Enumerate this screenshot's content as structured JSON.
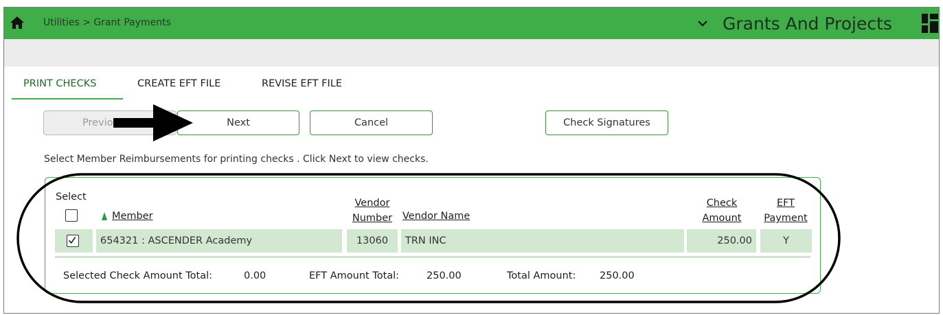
{
  "header": {
    "breadcrumb": "Utilities > Grant Payments",
    "module_title": "Grants And Projects"
  },
  "tabs": [
    {
      "label": "PRINT CHECKS",
      "active": true
    },
    {
      "label": "CREATE EFT FILE",
      "active": false
    },
    {
      "label": "REVISE EFT FILE",
      "active": false
    }
  ],
  "buttons": {
    "previous": "Previous",
    "next": "Next",
    "cancel": "Cancel",
    "check_signatures": "Check Signatures"
  },
  "instruction": "Select Member Reimbursements for printing checks . Click Next to view checks.",
  "table": {
    "headers": {
      "select": "Select",
      "member": "Member",
      "vendor_number_1": "Vendor",
      "vendor_number_2": "Number",
      "vendor_name": "Vendor Name",
      "check_amount_1": "Check",
      "check_amount_2": "Amount",
      "eft_payment_1": "EFT",
      "eft_payment_2": "Payment"
    },
    "rows": [
      {
        "selected": true,
        "member": "654321 : ASCENDER Academy",
        "vendor_number": "13060",
        "vendor_name": "TRN INC",
        "check_amount": "250.00",
        "eft_payment": "Y"
      }
    ]
  },
  "totals": {
    "selected_label": "Selected Check Amount Total:",
    "selected_value": "0.00",
    "eft_label": "EFT Amount Total:",
    "eft_value": "250.00",
    "total_label": "Total Amount:",
    "total_value": "250.00"
  },
  "colors": {
    "brand_green": "#3fae49",
    "row_green": "#d3e8d1"
  },
  "icons": {
    "home": "home-icon",
    "dropdown": "chevron-down-icon",
    "apps": "apps-grid-icon",
    "sort": "sort-ascending-icon"
  }
}
